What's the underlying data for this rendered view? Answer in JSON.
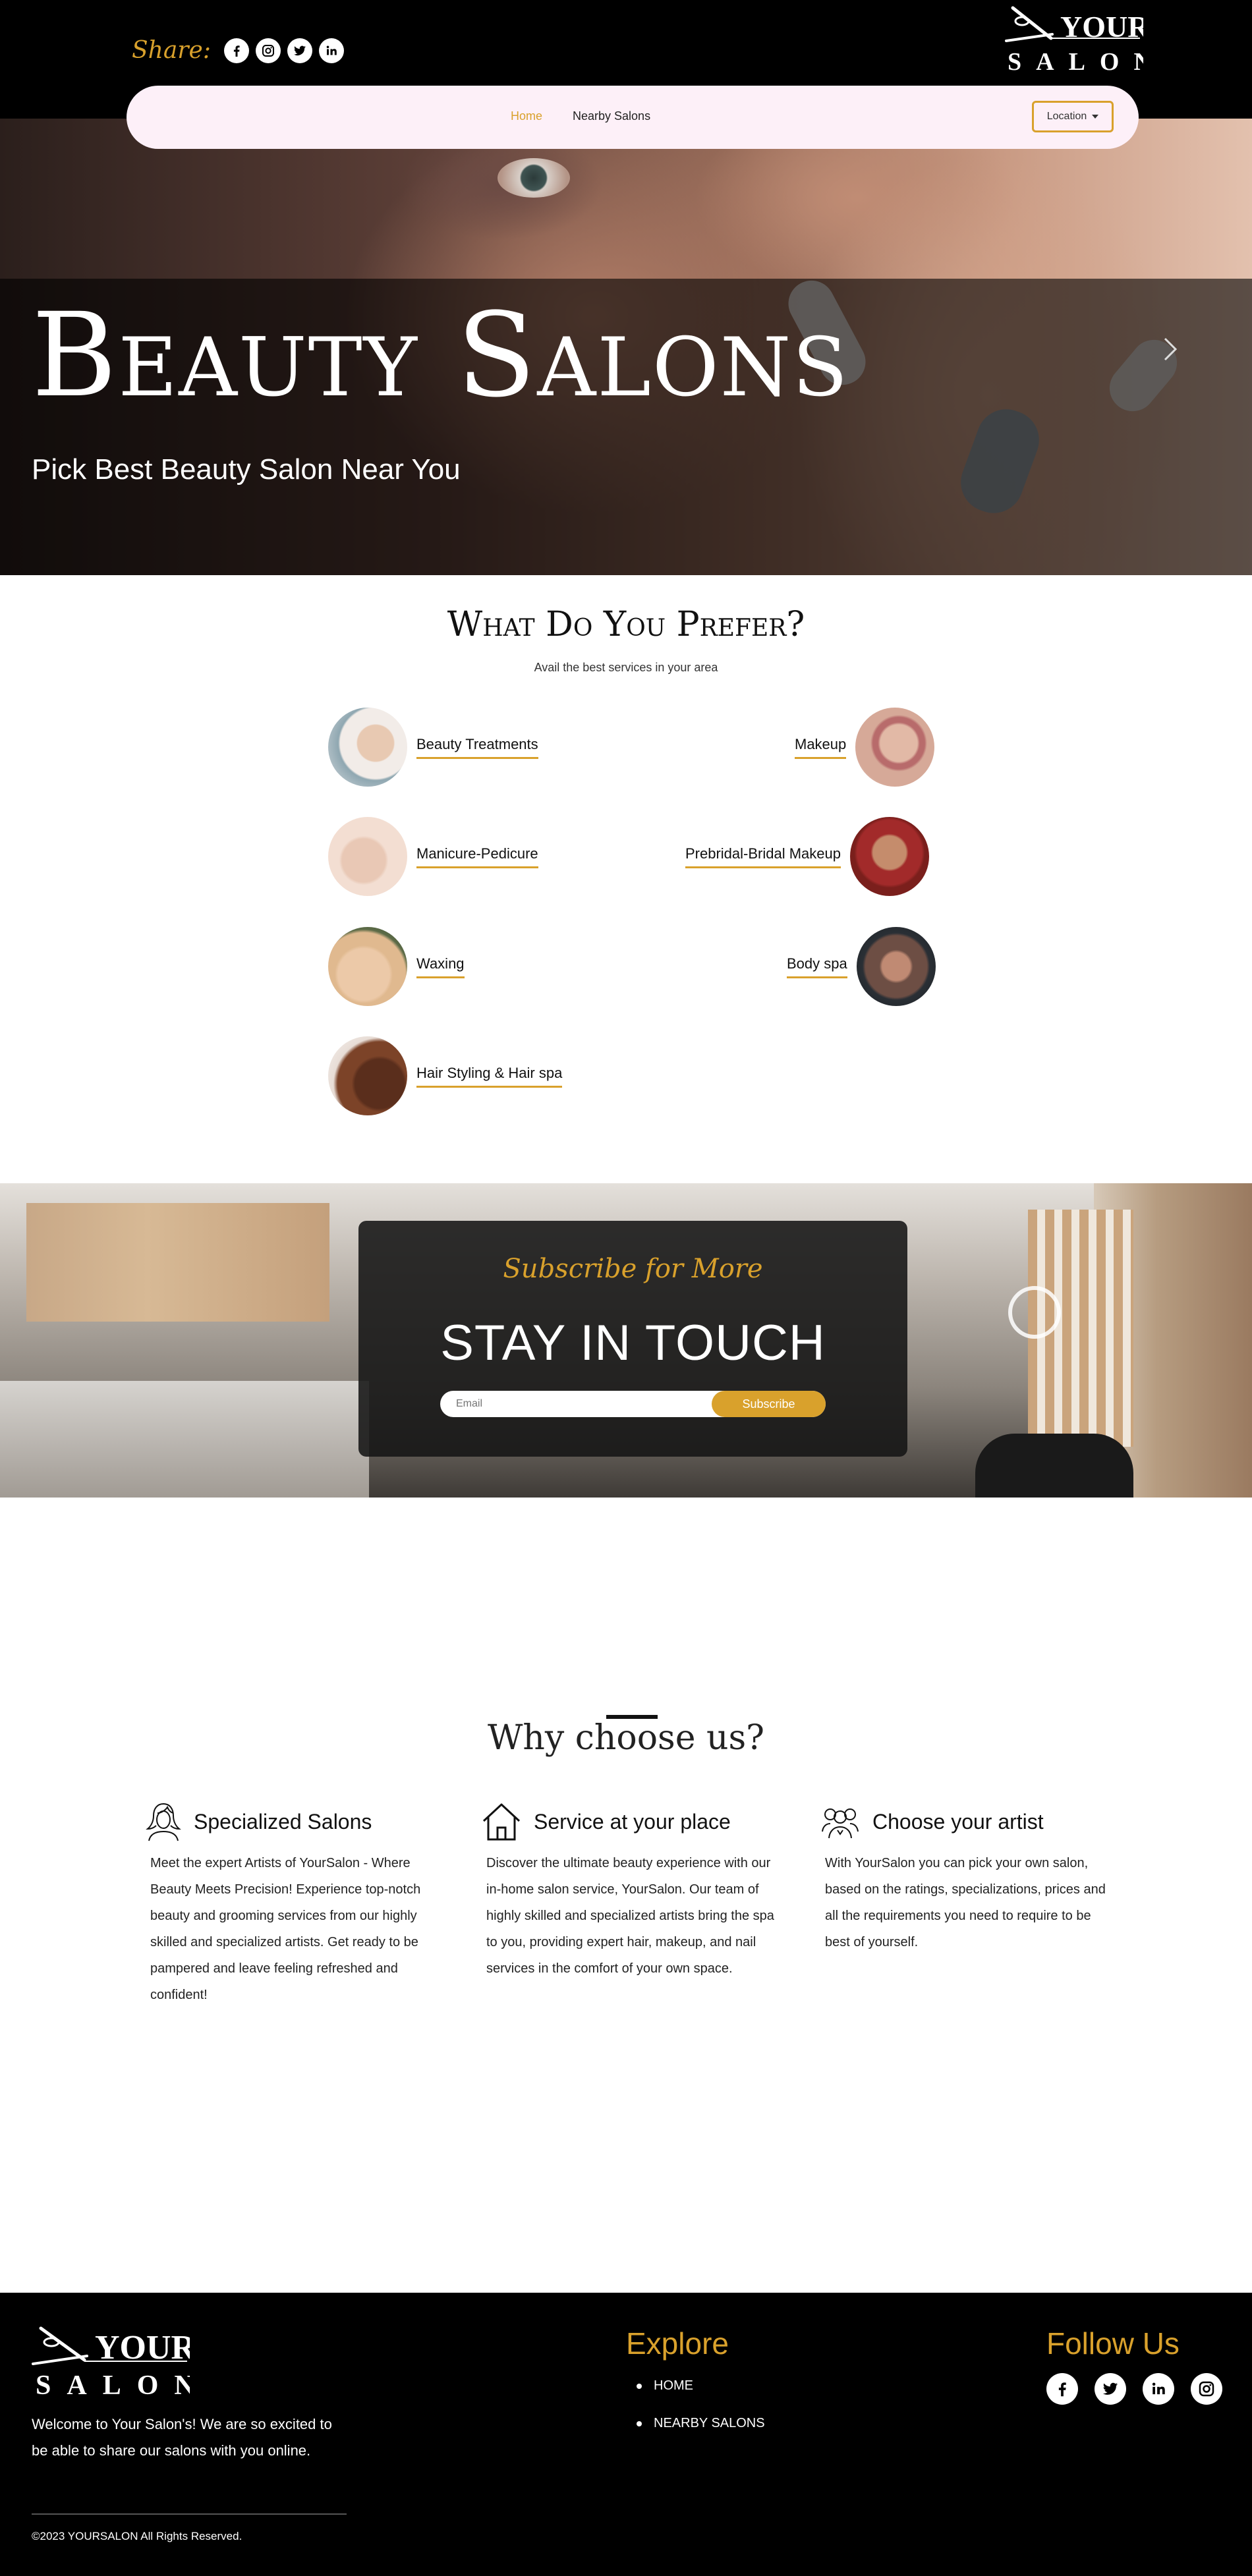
{
  "header": {
    "share_label": "Share:",
    "share_icons": [
      "facebook-icon",
      "instagram-icon",
      "twitter-icon",
      "linkedin-icon"
    ],
    "logo_text": {
      "top": "YOUR",
      "bottom": "SALON"
    },
    "nav": {
      "home": "Home",
      "nearby": "Nearby Salons",
      "location_button": "Location"
    }
  },
  "hero": {
    "title": "Beauty Salons",
    "subtitle": "Pick Best Beauty Salon Near You"
  },
  "prefer": {
    "title": "What Do You Prefer?",
    "subtitle": "Avail the best services in your area",
    "services": [
      {
        "label": "Beauty Treatments"
      },
      {
        "label": "Makeup"
      },
      {
        "label": "Manicure-Pedicure"
      },
      {
        "label": "Prebridal-Bridal Makeup"
      },
      {
        "label": "Waxing"
      },
      {
        "label": "Body spa"
      },
      {
        "label": "Hair Styling & Hair spa"
      }
    ]
  },
  "subscribe": {
    "script": "Subscribe for More",
    "heading": "STAY IN TOUCH",
    "email_placeholder": "Email",
    "button": "Subscribe"
  },
  "why": {
    "title": "Why choose us?",
    "features": [
      {
        "title": "Specialized Salons",
        "text": "Meet the expert Artists of YourSalon - Where Beauty Meets Precision! Experience top-notch beauty and grooming services from our highly skilled and specialized artists. Get ready to be pampered and leave feeling refreshed and confident!",
        "icon": "woman-icon"
      },
      {
        "title": "Service at your place",
        "text": "Discover the ultimate beauty experience with our in-home salon service, YourSalon. Our team of highly skilled and specialized artists bring the spa to you, providing expert hair, makeup, and nail services in the comfort of your own space.",
        "icon": "house-icon"
      },
      {
        "title": "Choose your artist",
        "text": "With YourSalon you can pick your own salon, based on the ratings, specializations, prices and all the requirements you need to require to be best of yourself.",
        "icon": "artists-icon"
      }
    ]
  },
  "footer": {
    "about": "Welcome to Your Salon's! We are so excited to be able to share our salons with you online.",
    "copyright": "©2023 YOURSALON All Rights Reserved.",
    "explore_title": "Explore",
    "explore_links": [
      "HOME",
      "NEARBY SALONS"
    ],
    "follow_title": "Follow Us",
    "follow_icons": [
      "facebook-icon",
      "twitter-icon",
      "linkedin-icon",
      "instagram-icon"
    ]
  },
  "colors": {
    "accent": "#d9a12c",
    "header_bg": "#000000",
    "nav_pill_bg": "#fdf0f8",
    "footer_bg": "#000000"
  }
}
